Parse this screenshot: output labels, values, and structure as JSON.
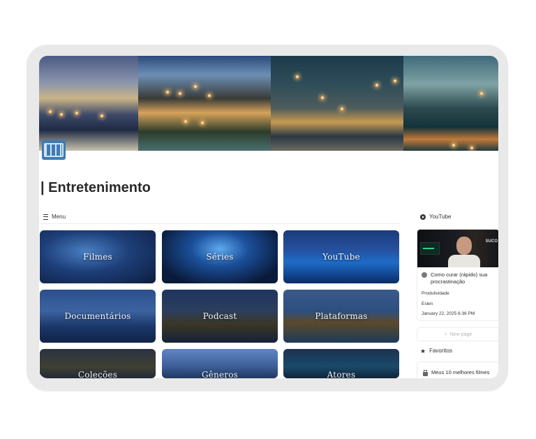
{
  "page": {
    "title": "| Entretenimento",
    "icon": "film-frames-icon"
  },
  "menu": {
    "heading": "Menu",
    "cards": [
      {
        "label": "Filmes"
      },
      {
        "label": "Séries"
      },
      {
        "label": "YouTube"
      },
      {
        "label": "Documentários"
      },
      {
        "label": "Podcast"
      },
      {
        "label": "Plataformas"
      },
      {
        "label": "Coleções"
      },
      {
        "label": "Gêneros"
      },
      {
        "label": "Atores"
      }
    ]
  },
  "youtube": {
    "heading": "YouTube",
    "video": {
      "thumbnail_text": "SUCO",
      "title": "Como curar (rápido) sua procrastinação",
      "category": "Produtividade",
      "author": "Eslen",
      "date": "January 22, 2025 6:36 PM"
    },
    "new_page_label": "New page"
  },
  "favoritos": {
    "heading": "Favoritos",
    "items": [
      {
        "label": "Meus 10 melhores filmes"
      }
    ]
  }
}
